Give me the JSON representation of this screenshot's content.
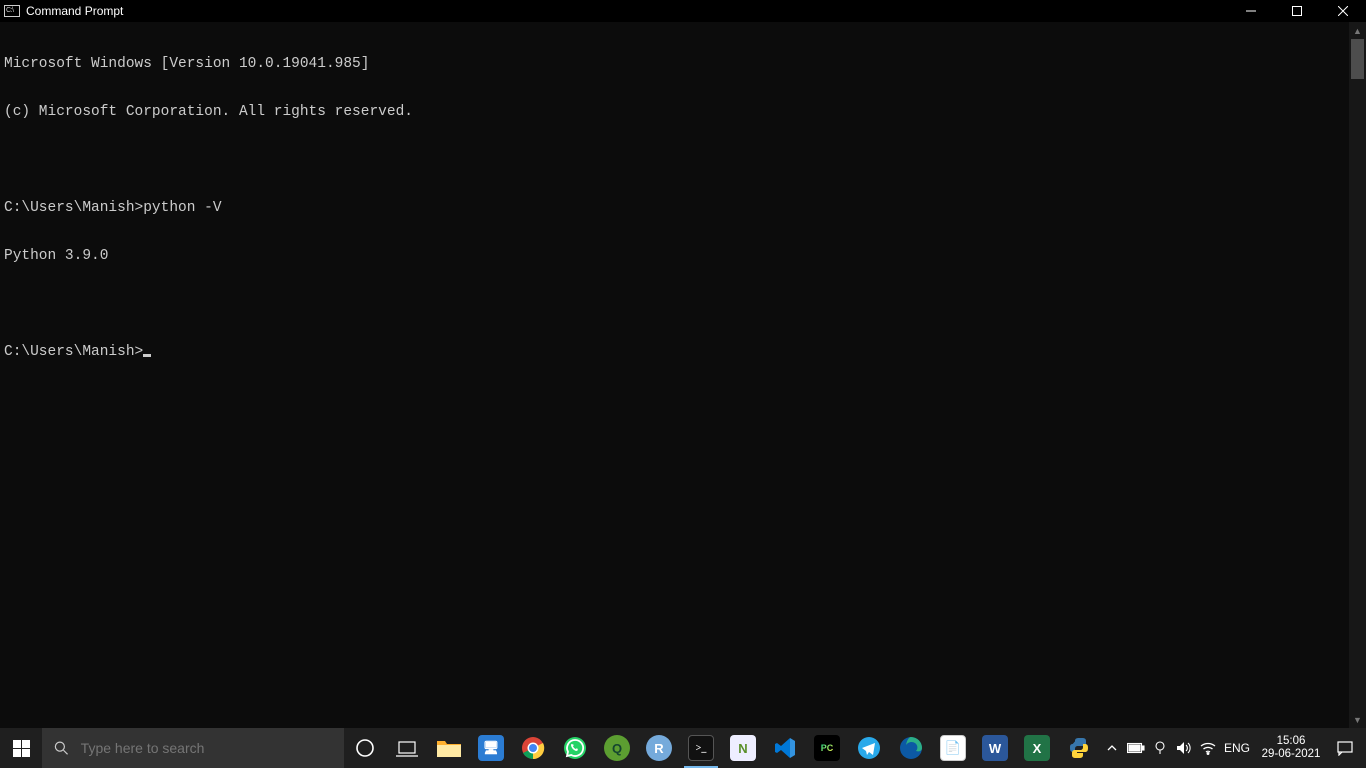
{
  "window": {
    "title": "Command Prompt"
  },
  "console": {
    "lines": [
      "Microsoft Windows [Version 10.0.19041.985]",
      "(c) Microsoft Corporation. All rights reserved.",
      "",
      "C:\\Users\\Manish>python -V",
      "Python 3.9.0",
      ""
    ],
    "prompt": "C:\\Users\\Manish>"
  },
  "taskbar": {
    "search_placeholder": "Type here to search",
    "apps": [
      {
        "name": "cortana",
        "label": "O",
        "bg": "transparent",
        "fg": "#fff",
        "active": false
      },
      {
        "name": "task-view",
        "label": "",
        "bg": "transparent",
        "active": false
      },
      {
        "name": "file-explorer",
        "label": "",
        "bg": "#ffcc4d",
        "active": false
      },
      {
        "name": "monitor-app",
        "label": "",
        "bg": "#2b7cd3",
        "active": false
      },
      {
        "name": "chrome",
        "label": "",
        "bg": "",
        "active": false
      },
      {
        "name": "whatsapp",
        "label": "",
        "bg": "#25d366",
        "active": false
      },
      {
        "name": "qbittorrent",
        "label": "q",
        "bg": "#6aa84f",
        "active": false
      },
      {
        "name": "rstudio",
        "label": "R",
        "bg": "#75aadb",
        "active": false
      },
      {
        "name": "cmd",
        "label": "",
        "bg": "#222",
        "active": true
      },
      {
        "name": "notepadpp",
        "label": "",
        "bg": "#a4c639",
        "active": false
      },
      {
        "name": "vscode",
        "label": "",
        "bg": "#0078d7",
        "active": false
      },
      {
        "name": "pycharm",
        "label": "PC",
        "bg": "#21d789",
        "active": false
      },
      {
        "name": "telegram",
        "label": "",
        "bg": "#29a9ea",
        "active": false
      },
      {
        "name": "edge",
        "label": "",
        "bg": "#0c59a4",
        "active": false
      },
      {
        "name": "word-doc",
        "label": "",
        "bg": "#2b579a",
        "active": false
      },
      {
        "name": "word",
        "label": "W",
        "bg": "#2b579a",
        "active": false
      },
      {
        "name": "excel",
        "label": "X",
        "bg": "#217346",
        "active": false
      },
      {
        "name": "python",
        "label": "",
        "bg": "#3776ab",
        "active": false
      }
    ],
    "tray": {
      "lang": "ENG",
      "time": "15:06",
      "date": "29-06-2021"
    }
  }
}
